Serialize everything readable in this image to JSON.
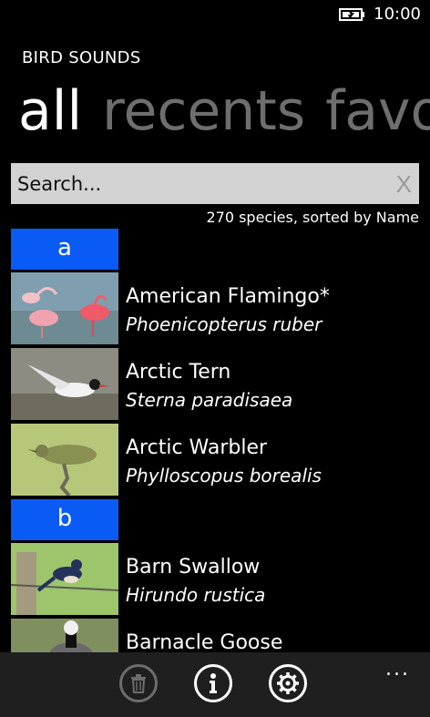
{
  "status": {
    "time": "10:00"
  },
  "app": {
    "title": "BIRD SOUNDS"
  },
  "pivots": [
    {
      "label": "all",
      "active": true
    },
    {
      "label": "recents",
      "active": false
    },
    {
      "label": "favo",
      "active": false
    }
  ],
  "search": {
    "placeholder": "Search...",
    "clear_label": "X"
  },
  "summary": "270 species, sorted by Name",
  "groups": [
    {
      "letter": "a",
      "items": [
        {
          "name": "American Flamingo*",
          "latin": "Phoenicopterus ruber"
        },
        {
          "name": "Arctic Tern",
          "latin": "Sterna paradisaea"
        },
        {
          "name": "Arctic Warbler",
          "latin": "Phylloscopus borealis"
        }
      ]
    },
    {
      "letter": "b",
      "items": [
        {
          "name": "Barn Swallow",
          "latin": "Hirundo rustica"
        },
        {
          "name": "Barnacle Goose",
          "latin": ""
        }
      ]
    }
  ],
  "appbar": {
    "buttons": [
      {
        "icon": "trash-icon",
        "enabled": false
      },
      {
        "icon": "info-icon",
        "enabled": true
      },
      {
        "icon": "settings-icon",
        "enabled": true
      }
    ],
    "more_label": "..."
  },
  "colors": {
    "accent": "#0a5bf5",
    "search_bg": "#d2d2d2",
    "inactive_pivot": "#6e6e6e",
    "appbar_bg": "#1f1f1f"
  }
}
